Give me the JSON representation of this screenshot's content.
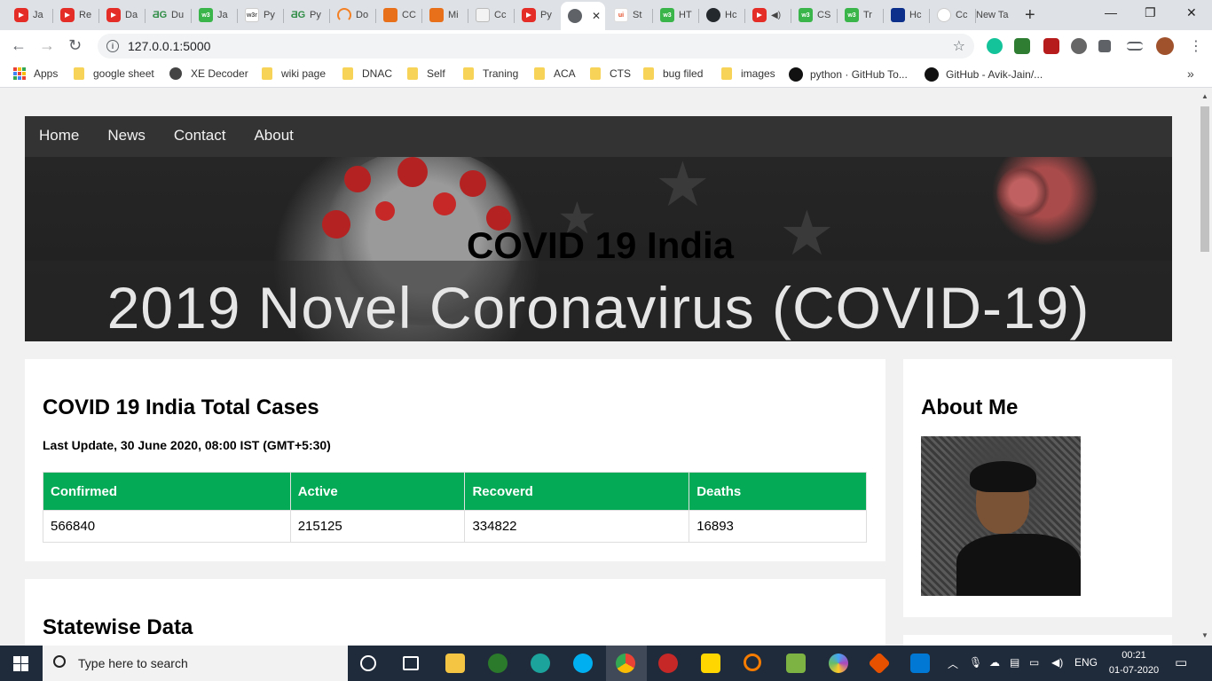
{
  "browser": {
    "tabs": [
      {
        "title": "Ja",
        "favicon": "youtube-icon"
      },
      {
        "title": "Re",
        "favicon": "youtube-icon"
      },
      {
        "title": "Da",
        "favicon": "youtube-icon"
      },
      {
        "title": "Du",
        "favicon": "geeksforgeeks-icon"
      },
      {
        "title": "Ja",
        "favicon": "green-w3-icon"
      },
      {
        "title": "Py",
        "favicon": "w3schools-icon"
      },
      {
        "title": "Py",
        "favicon": "geeksforgeeks-icon"
      },
      {
        "title": "Do",
        "favicon": "stackoverflow-icon"
      },
      {
        "title": "CC",
        "favicon": "book-icon"
      },
      {
        "title": "Mi",
        "favicon": "book-icon"
      },
      {
        "title": "Cc",
        "favicon": "cube-icon"
      },
      {
        "title": "Py",
        "favicon": "youtube-icon"
      },
      {
        "title": "",
        "favicon": "globe-icon",
        "active": true
      },
      {
        "title": "St",
        "favicon": "ui-icon"
      },
      {
        "title": "HT",
        "favicon": "green-w3-icon"
      },
      {
        "title": "Hc",
        "favicon": "dark-circle-icon"
      },
      {
        "title": "",
        "favicon": "youtube-icon"
      },
      {
        "title": "CS",
        "favicon": "green-w3-icon"
      },
      {
        "title": "Tr",
        "favicon": "green-w3-icon"
      },
      {
        "title": "Hc",
        "favicon": "blue-square-icon"
      },
      {
        "title": "Cc",
        "favicon": "cloud-icon"
      },
      {
        "title": "New Ta",
        "favicon": ""
      }
    ],
    "address": "127.0.0.1:5000",
    "bookmarks": [
      "Apps",
      "google sheet",
      "XE Decoder",
      "wiki page",
      "DNAC",
      "Self",
      "Traning",
      "ACA",
      "CTS",
      "bug filed",
      "images",
      "python · GitHub To...",
      "GitHub - Avik-Jain/..."
    ]
  },
  "page": {
    "nav": [
      "Home",
      "News",
      "Contact",
      "About"
    ],
    "banner": {
      "title": "COVID 19 India",
      "image_text": "2019 Novel Coronavirus (COVID-19)"
    },
    "cases": {
      "heading": "COVID 19 India Total Cases",
      "update": "Last Update, 30 June 2020, 08:00 IST (GMT+5:30)",
      "headers": [
        "Confirmed",
        "Active",
        "Recoverd",
        "Deaths"
      ],
      "values": [
        "566840",
        "215125",
        "334822",
        "16893"
      ]
    },
    "statewise": {
      "heading": "Statewise Data"
    },
    "about": {
      "heading": "About Me"
    }
  },
  "taskbar": {
    "search_placeholder": "Type here to search",
    "language": "ENG",
    "time": "00:21",
    "date": "01-07-2020"
  },
  "colors": {
    "table_header": "#04aa56",
    "nav_bg": "#333333",
    "page_bg": "#f1f1f1"
  }
}
